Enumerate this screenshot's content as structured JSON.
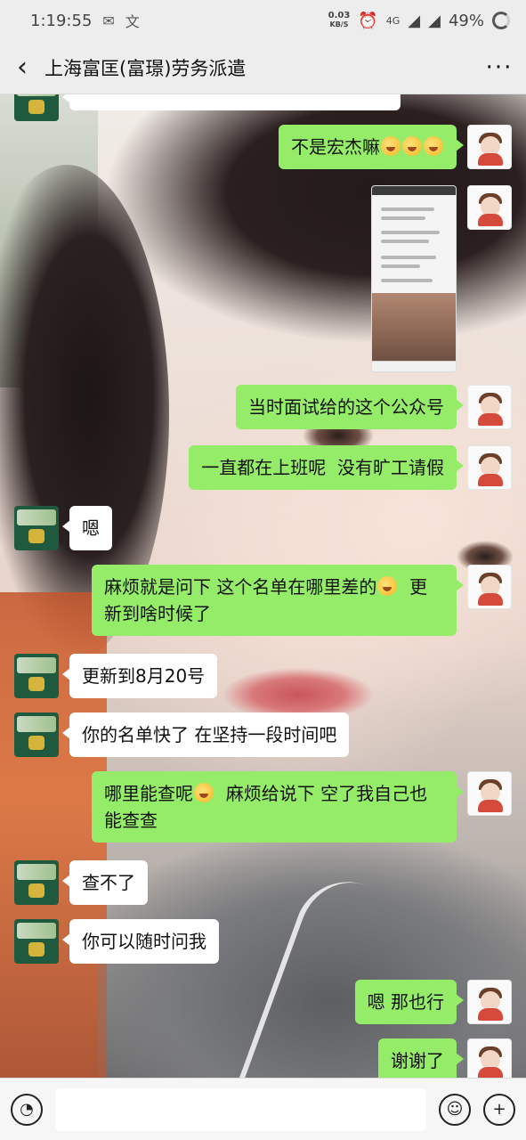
{
  "status_bar": {
    "time": "1:19:55",
    "net_speed_value": "0.03",
    "net_speed_unit": "KB/S",
    "signal": "4G",
    "battery": "49%"
  },
  "nav": {
    "title": "上海富匡(富璟)劳务派遣"
  },
  "messages": [
    {
      "side": "right",
      "text": "不是宏杰嘛"
    },
    {
      "side": "right",
      "type": "image"
    },
    {
      "side": "right",
      "text": "当时面试给的这个公众号"
    },
    {
      "side": "right",
      "text": "一直都在上班呢  没有旷工请假"
    },
    {
      "side": "left",
      "text": "嗯"
    },
    {
      "side": "right",
      "text_a": "麻烦就是问下 这个名单在哪里差的",
      "text_b": "  更新到啥时候了"
    },
    {
      "side": "left",
      "text": "更新到8月20号"
    },
    {
      "side": "left",
      "text": "你的名单快了 在坚持一段时间吧"
    },
    {
      "side": "right",
      "text_a": "哪里能查呢",
      "text_b": "  麻烦给说下 空了我自己也能查查"
    },
    {
      "side": "left",
      "text": "查不了"
    },
    {
      "side": "left",
      "text": "你可以随时问我"
    },
    {
      "side": "right",
      "text": "嗯 那也行"
    },
    {
      "side": "right",
      "text": "谢谢了"
    }
  ],
  "colors": {
    "my_bubble": "#95ec69",
    "their_bubble": "#ffffff",
    "bar_bg": "#ededed"
  }
}
